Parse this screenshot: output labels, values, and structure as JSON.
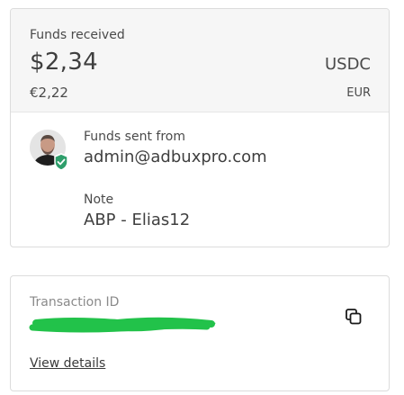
{
  "funds": {
    "received_label": "Funds received",
    "amount": "$2,34",
    "currency": "USDC",
    "amount_eur": "€2,22",
    "currency_eur": "EUR",
    "sent_from_label": "Funds sent from",
    "sender": "admin@adbuxpro.com",
    "note_label": "Note",
    "note": "ABP - Elias12"
  },
  "transaction": {
    "id_label": "Transaction ID",
    "view_details": "View details"
  },
  "icons": {
    "avatar": "user-avatar",
    "badge": "verified-shield-icon",
    "copy": "copy-icon"
  },
  "colors": {
    "panel_bg": "#f6f6f6",
    "border": "#dcdcdc",
    "verified_green": "#2e9e6b",
    "redaction_green": "#22c24a"
  }
}
